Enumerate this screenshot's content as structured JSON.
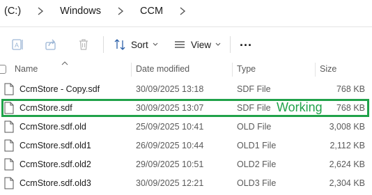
{
  "breadcrumb": {
    "drive": "(C:)",
    "folder1": "Windows",
    "folder2": "CCM"
  },
  "toolbar": {
    "sort_label": "Sort",
    "view_label": "View",
    "more_label": "..."
  },
  "columns": {
    "name": "Name",
    "date": "Date modified",
    "type": "Type",
    "size": "Size"
  },
  "files": [
    {
      "name": "CcmStore - Copy.sdf",
      "date": "30/09/2025 13:18",
      "type": "SDF File",
      "size": "768 KB"
    },
    {
      "name": "CcmStore.sdf",
      "date": "30/09/2025 13:07",
      "type": "SDF File",
      "size": "768 KB"
    },
    {
      "name": "CcmStore.sdf.old",
      "date": "25/09/2025 10:41",
      "type": "OLD File",
      "size": "3,008 KB"
    },
    {
      "name": "CcmStore.sdf.old1",
      "date": "26/09/2025 10:44",
      "type": "OLD1 File",
      "size": "2,112 KB"
    },
    {
      "name": "CcmStore.sdf.old2",
      "date": "29/09/2025 10:51",
      "type": "OLD2 File",
      "size": "2,624 KB"
    },
    {
      "name": "CcmStore.sdf.old3",
      "date": "30/09/2025 12:21",
      "type": "OLD3 File",
      "size": "2,304 KB"
    }
  ],
  "annotation": {
    "text": "Working",
    "color": "#20a24a"
  }
}
